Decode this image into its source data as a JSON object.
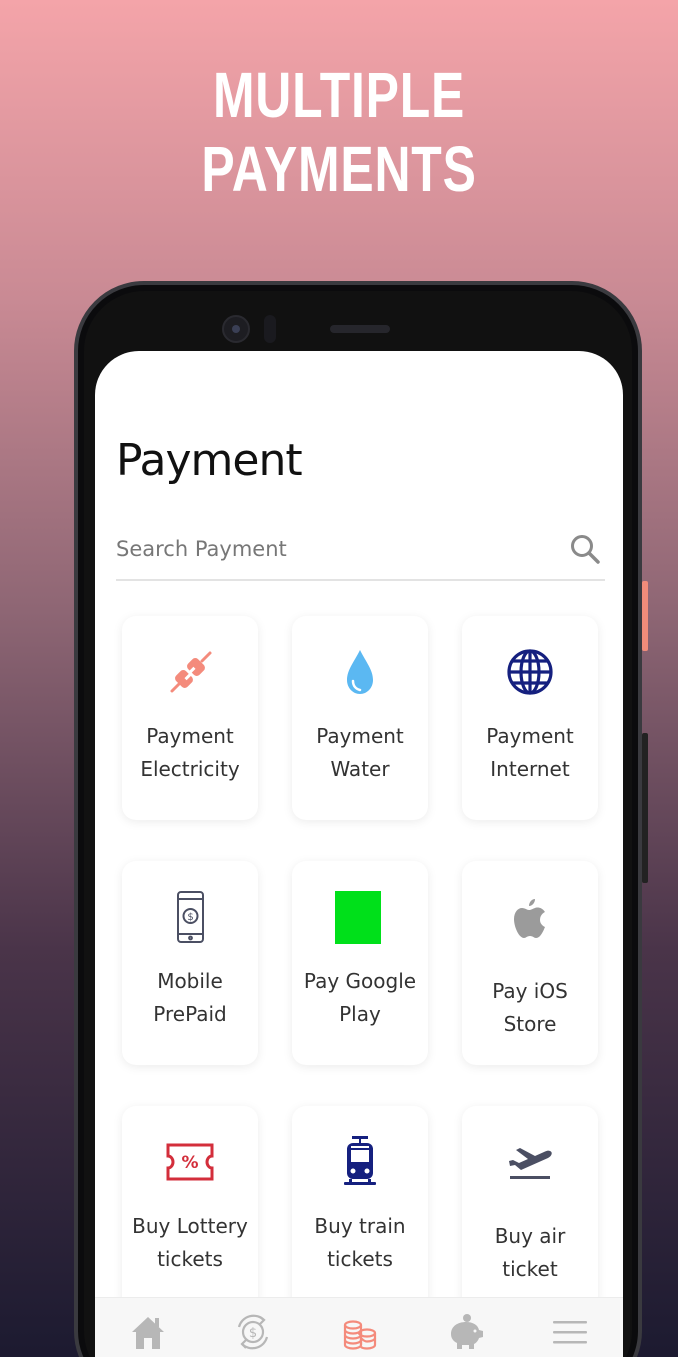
{
  "headline": "MULTIPLE PAYMENTS",
  "page": {
    "title": "Payment"
  },
  "search": {
    "placeholder": "Search Payment",
    "icon": "search-icon"
  },
  "colors": {
    "accent": "#f48b7c",
    "internet": "#15207f",
    "water": "#5bb8f2",
    "lottery": "#d32e3b",
    "google_play": "#00e01a",
    "apple": "#9b9b9b",
    "device": "#4b4f63"
  },
  "services": [
    {
      "label_line1": "Payment",
      "label_line2": "Electricity",
      "icon": "plug-icon"
    },
    {
      "label_line1": "Payment",
      "label_line2": "Water",
      "icon": "water-drop-icon"
    },
    {
      "label_line1": "Payment",
      "label_line2": "Internet",
      "icon": "globe-icon"
    },
    {
      "label_line1": "Mobile",
      "label_line2": "PrePaid",
      "icon": "mobile-money-icon"
    },
    {
      "label_line1": "Pay Google",
      "label_line2": "Play",
      "icon": "google-play-icon"
    },
    {
      "label_line1": "Pay iOS Store",
      "label_line2": "",
      "icon": "apple-icon"
    },
    {
      "label_line1": "Buy Lottery",
      "label_line2": "tickets",
      "icon": "lottery-ticket-icon"
    },
    {
      "label_line1": "Buy train",
      "label_line2": "tickets",
      "icon": "train-icon"
    },
    {
      "label_line1": "Buy air ticket",
      "label_line2": "",
      "icon": "airplane-icon"
    }
  ],
  "bottom_nav": [
    {
      "name": "home",
      "icon": "home-icon",
      "active": false
    },
    {
      "name": "exchange",
      "icon": "currency-exchange-icon",
      "active": false
    },
    {
      "name": "payment",
      "icon": "coins-icon",
      "active": true
    },
    {
      "name": "savings",
      "icon": "piggy-bank-icon",
      "active": false
    },
    {
      "name": "menu",
      "icon": "menu-icon",
      "active": false
    }
  ]
}
